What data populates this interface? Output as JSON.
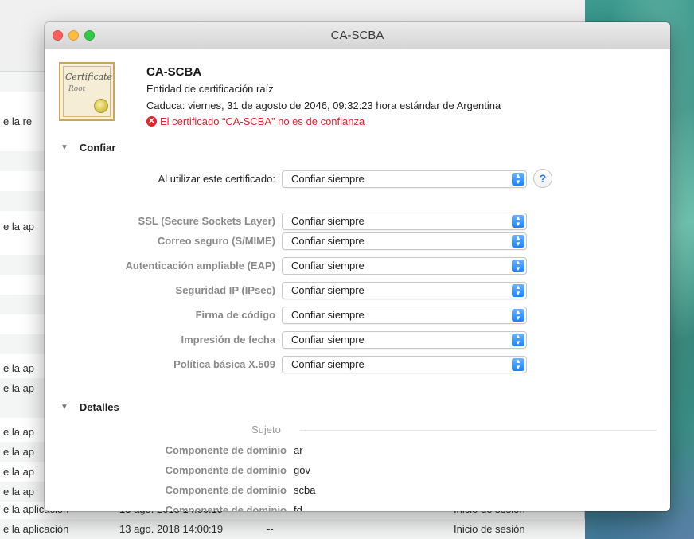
{
  "background": {
    "rows": [
      {
        "c1": "e la re",
        "c2": "",
        "c3": "",
        "c4": ""
      },
      {
        "c1": "e la ap",
        "c2": "",
        "c3": "",
        "c4": ""
      },
      {
        "c1": "e la ap",
        "c2": "",
        "c3": "",
        "c4": ""
      },
      {
        "c1": "e la ap",
        "c2": "",
        "c3": "",
        "c4": ""
      },
      {
        "c1": "e la ap",
        "c2": "",
        "c3": "",
        "c4": ""
      },
      {
        "c1": "e la ap",
        "c2": "",
        "c3": "",
        "c4": ""
      },
      {
        "c1": "e la ap",
        "c2": "",
        "c3": "",
        "c4": ""
      },
      {
        "c1": "e la ap",
        "c2": "",
        "c3": "",
        "c4": ""
      },
      {
        "c1": "e la aplicación",
        "c2": "13 ago. 2018 14:00:19",
        "c3": "--",
        "c4": "Inicio de sesión"
      }
    ],
    "partial_row": {
      "c1": "e la aplicación",
      "c2": "13 ago. 2018 14:00:19",
      "c4": "Inicio de sesión"
    }
  },
  "window": {
    "title": "CA-SCBA"
  },
  "certificate": {
    "icon_script": "Certificate",
    "icon_root": "Root",
    "name": "CA-SCBA",
    "type": "Entidad de certificación raíz",
    "expires": "Caduca: viernes, 31 de agosto de 2046, 09:32:23 hora estándar de Argentina",
    "warning": "El certificado “CA-SCBA” no es de confianza",
    "warning_color": "#e0262b"
  },
  "trust": {
    "heading": "Confiar",
    "main": {
      "label": "Al utilizar este certificado:",
      "value": "Confiar siempre"
    },
    "help": "?",
    "rows": [
      {
        "label": "SSL (Secure Sockets Layer)",
        "value": "Confiar siempre"
      },
      {
        "label": "Correo seguro (S/MIME)",
        "value": "Confiar siempre"
      },
      {
        "label": "Autenticación ampliable (EAP)",
        "value": "Confiar siempre"
      },
      {
        "label": "Seguridad IP (IPsec)",
        "value": "Confiar siempre"
      },
      {
        "label": "Firma de código",
        "value": "Confiar siempre"
      },
      {
        "label": "Impresión de fecha",
        "value": "Confiar siempre"
      },
      {
        "label": "Política básica X.509",
        "value": "Confiar siempre"
      }
    ]
  },
  "details": {
    "heading": "Detalles",
    "subject_label": "Sujeto",
    "rows": [
      {
        "key": "Componente de dominio",
        "value": "ar"
      },
      {
        "key": "Componente de dominio",
        "value": "gov"
      },
      {
        "key": "Componente de dominio",
        "value": "scba"
      },
      {
        "key": "Componente de dominio",
        "value": "fd"
      }
    ]
  },
  "accent": "#1a82fb"
}
